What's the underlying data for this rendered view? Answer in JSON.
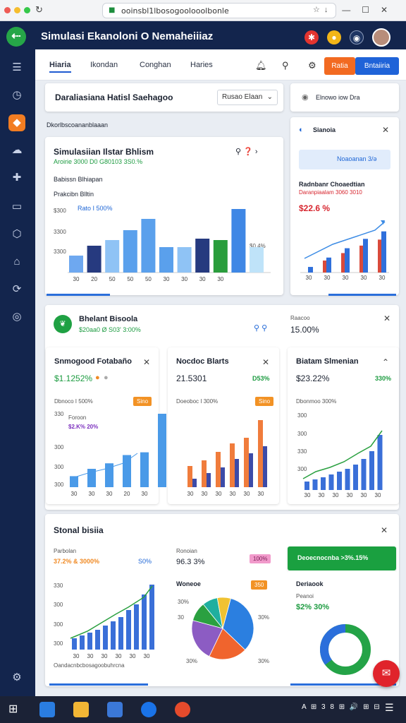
{
  "browser": {
    "url": "ooinsbl1lbosogoolooolbonle",
    "reload": "↻",
    "star": "☆",
    "download": "↓",
    "window": [
      "—",
      "☐",
      "✕"
    ]
  },
  "app": {
    "title": "Simulasi Ekanoloni O Nemaheiiiaz",
    "logo": "⇠"
  },
  "nav": {
    "tabs": [
      "Hiaria",
      "Ikondan",
      "Conghan",
      "Haries"
    ],
    "btn_orange": "Ratia",
    "btn_blue": "Bntaiiria"
  },
  "header": {
    "title": "Daraliasiana Hatisl Saehagoo",
    "select": "Rusao Elaan",
    "right_label": "Elnowo iow Dra"
  },
  "section1_label": "Dkorlbscoananblaaan",
  "card_main": {
    "title": "Simulasiian Ilstar Bhlism",
    "subtitle": "Aroirie 3000 D0 G80103 3S0.%",
    "label": "Babissn Blhiapan",
    "chart_label": "Prakcibn Blltin",
    "legend": "Rato I 500%",
    "yticks": [
      "$300",
      "3300",
      "3300"
    ],
    "xticks": [
      "30",
      "20",
      "50",
      "50",
      "50",
      "30",
      "30",
      "30",
      "30"
    ],
    "note": "$0.4%"
  },
  "card_right": {
    "title": "Sianoia",
    "btn": "Noaoanan 3/ə",
    "label": "Radnbanr Choaedtian",
    "sublabel": "Daranpiaalam 3060 3010",
    "value": "$22.6 %",
    "xticks": [
      "30",
      "30",
      "30",
      "30",
      "30"
    ]
  },
  "card_mid": {
    "title": "Bhelant Bisoola",
    "sub": "$20aa0 Ø S03' 3:00%",
    "right_label": "Raacoo",
    "right_value": "15.00%"
  },
  "mini1": {
    "title": "Snmogood Fotabaño",
    "value": "$1.1252%",
    "label": "Dbnoco I 500%",
    "badge": "Sino",
    "series_label": "Foroon",
    "note": "$2.K% 20%",
    "yticks": [
      "330",
      "300",
      "300",
      "300"
    ],
    "xticks": [
      "30",
      "30",
      "30",
      "20",
      "30"
    ]
  },
  "mini2": {
    "title": "Nocdoc Blarts",
    "value": "21.5301",
    "value_right": "D53%",
    "label": "Doeoboc I 300%",
    "badge": "Sino",
    "xticks": [
      "30",
      "30",
      "30",
      "30",
      "30",
      "30"
    ]
  },
  "mini3": {
    "title": "Biatam Slmenian",
    "value": "$23.22%",
    "value_right": "330%",
    "label": "Dbonmoo 300%",
    "yticks": [
      "300",
      "300",
      "330",
      "300",
      "300"
    ],
    "xticks": [
      "30",
      "30",
      "30",
      "30",
      "30",
      "30"
    ]
  },
  "bottom": {
    "title": "Stonal bisiia",
    "left_label": "Parbolan",
    "left_value": "37.2% & 3000%",
    "left_right": "S0%",
    "left_yticks": [
      "330",
      "300",
      "300",
      "300"
    ],
    "left_xticks": [
      "30",
      "30",
      "30",
      "30",
      "30",
      "30"
    ],
    "left_footer": "Oandacnbcbosagoobuhrcna",
    "pie_label": "Ronoian",
    "pie_value": "96.3 3%",
    "pie_badge": "100%",
    "pie_title": "Woneoe",
    "pie_badge2": "350",
    "pie_ticks": [
      "30%",
      "30",
      "30%",
      "30%",
      "30%"
    ],
    "green_banner": "Deoecnocnba >3%.15%",
    "donut_title": "Deriaook",
    "donut_label": "Peanoi",
    "donut_value": "$2% 30%"
  },
  "chart_data": [
    {
      "type": "bar",
      "title": "Prakcibn Blltin",
      "categories": [
        "30",
        "20",
        "50",
        "50",
        "50",
        "30",
        "30",
        "30",
        "30"
      ],
      "series": [
        {
          "name": "Rato",
          "values": [
            120,
            190,
            230,
            300,
            380,
            180,
            180,
            240,
            230,
            450,
            180
          ]
        }
      ],
      "colors": [
        "#6ea8f0",
        "#263a7f",
        "#8fc3f5",
        "#5aa0ec",
        "#5aa0ec",
        "#5aa0ec",
        "#8fc3f5",
        "#263a7f",
        "#2a9d3c",
        "#3f87e5",
        "#bfe3f9"
      ]
    },
    {
      "type": "bar",
      "title": "Radnbanr Choaedtian",
      "categories": [
        "30",
        "30",
        "30",
        "30",
        "30"
      ],
      "series": [
        {
          "values": [
            15,
            40,
            65,
            90,
            110
          ]
        }
      ]
    }
  ],
  "taskbar": {
    "time": "A ⊞ 3 8 ⊞ 🔊 ⊞ ⊟"
  }
}
